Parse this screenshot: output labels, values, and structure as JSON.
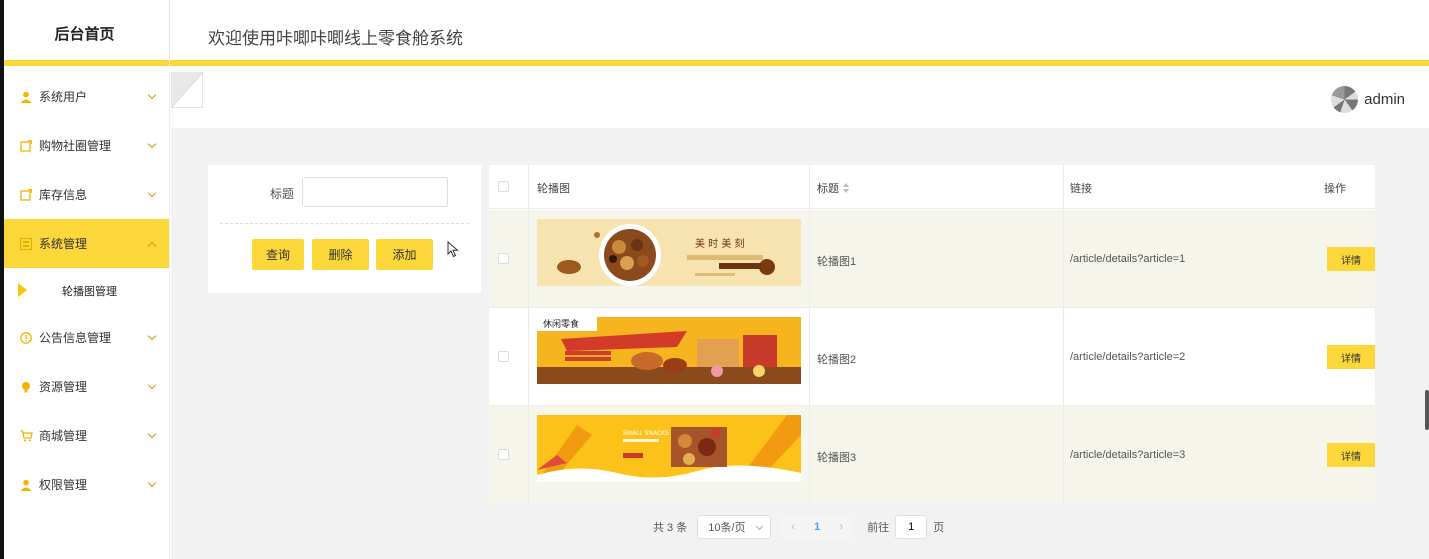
{
  "header": {
    "logo": "后台首页",
    "welcome": "欢迎使用咔唧咔唧线上零食舱系统"
  },
  "user": {
    "name": "admin"
  },
  "sidebar": {
    "items": [
      {
        "label": "系统用户",
        "icon": "user-icon"
      },
      {
        "label": "购物社圈管理",
        "icon": "doc-icon"
      },
      {
        "label": "库存信息",
        "icon": "doc-icon"
      },
      {
        "label": "系统管理",
        "icon": "settings-icon",
        "active": true
      },
      {
        "label": "公告信息管理",
        "icon": "info-icon"
      },
      {
        "label": "资源管理",
        "icon": "bulb-icon"
      },
      {
        "label": "商城管理",
        "icon": "cart-icon"
      },
      {
        "label": "权限管理",
        "icon": "user-icon"
      }
    ],
    "sub_items": [
      {
        "label": "轮播图管理"
      }
    ]
  },
  "search": {
    "title_label": "标题",
    "title_value": "",
    "query_label": "查询",
    "delete_label": "删除",
    "add_label": "添加"
  },
  "table": {
    "headers": {
      "image": "轮播图",
      "title": "标题",
      "link": "链接",
      "action": "操作"
    },
    "rows": [
      {
        "title": "轮播图1",
        "link": "/article/details?article=1",
        "action": "详情",
        "banner_text": "美 时 美 刻"
      },
      {
        "title": "轮播图2",
        "link": "/article/details?article=2",
        "action": "详情",
        "banner_text": "休闲零食"
      },
      {
        "title": "轮播图3",
        "link": "/article/details?article=3",
        "action": "详情",
        "banner_text": "SMALL SNACKS"
      }
    ]
  },
  "pagination": {
    "total": "共 3 条",
    "page_size": "10条/页",
    "current_page": "1",
    "goto_label": "前往",
    "goto_value": "1",
    "page_unit": "页"
  },
  "colors": {
    "accent": "#fcd73a",
    "page_link": "#409eff"
  }
}
